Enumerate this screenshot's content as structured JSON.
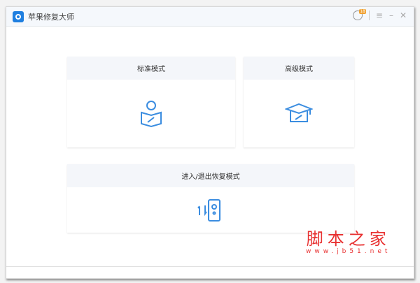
{
  "window": {
    "title": "苹果修复大师",
    "badge": "18"
  },
  "cards": {
    "standard": "标准模式",
    "advanced": "高级模式",
    "recovery": "进入/退出恢复模式"
  },
  "watermark": {
    "line1": "脚本之家",
    "line2": "www.jb51.net"
  },
  "colors": {
    "accent": "#3b8de0",
    "watermark": "#e83030"
  }
}
